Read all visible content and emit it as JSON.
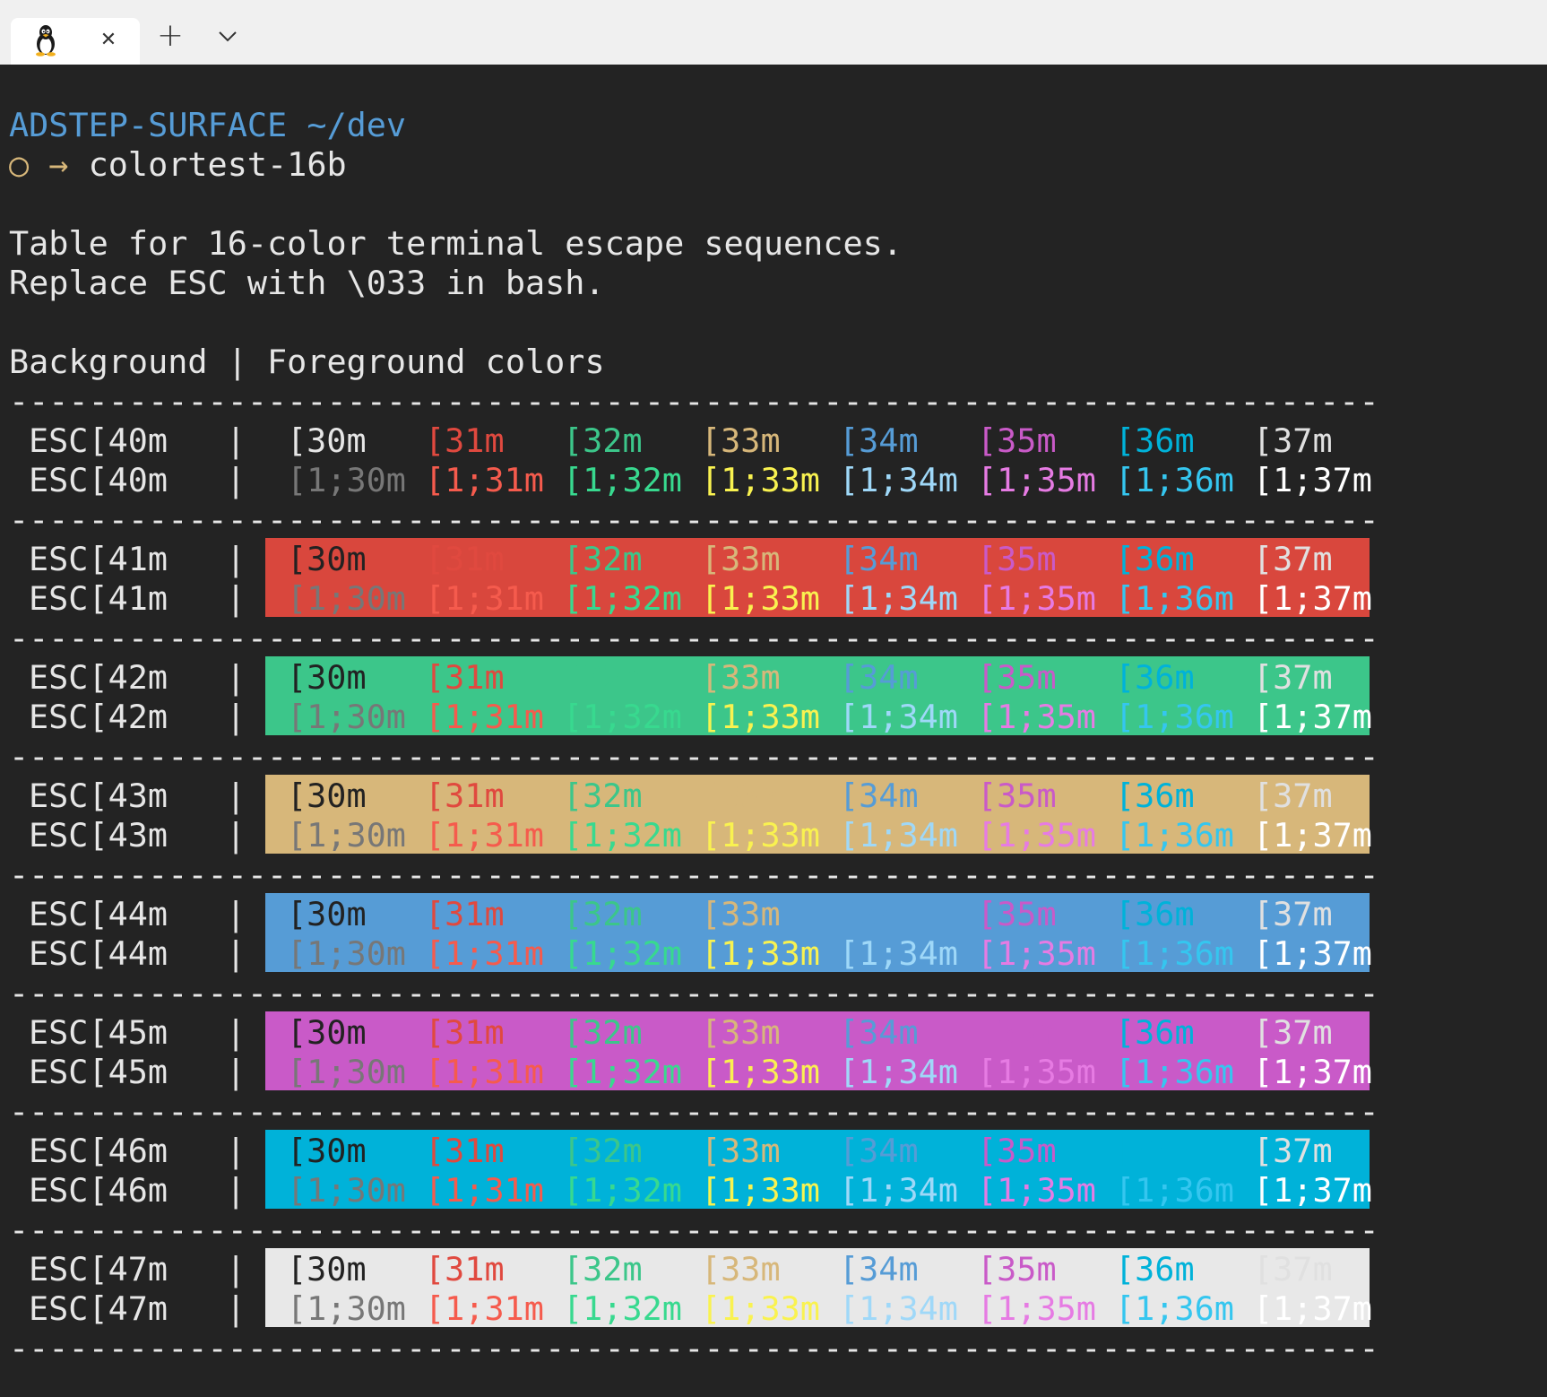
{
  "tabstrip": {
    "tab_icon": "linux-penguin-icon",
    "close_glyph": "✕",
    "new_tab_glyph": "+",
    "menu_glyph": "⌄"
  },
  "terminal": {
    "prompt_host": "ADSTEP-SURFACE",
    "prompt_path": "~/dev",
    "prompt_symbol": "○ →",
    "command": "colortest-16b",
    "info_line1": "Table for 16-color terminal escape sequences.",
    "info_line2": "Replace ESC with \\033 in bash.",
    "header": "Background | Foreground colors",
    "divider": "---------------------------------------------------------------------",
    "pipe": "|",
    "colors": {
      "normal": [
        "#222222",
        "#e0493f",
        "#3cc68a",
        "#d7b77a",
        "#569cd6",
        "#c95ac8",
        "#00b2d9",
        "#e0e0e0"
      ],
      "bright": [
        "#777777",
        "#f55b4d",
        "#38d98f",
        "#f9f250",
        "#9fd8f8",
        "#e67be3",
        "#35c6ef",
        "#ffffff"
      ],
      "background": [
        "#232323",
        "#d9473d",
        "#3cc68a",
        "#d7b77a",
        "#569cd6",
        "#c95ac8",
        "#00b2d9",
        "#e8e8e8"
      ]
    },
    "fg_codes_normal": [
      "[30m",
      "[31m",
      "[32m",
      "[33m",
      "[34m",
      "[35m",
      "[36m",
      "[37m"
    ],
    "fg_codes_bold": [
      "[1;30m",
      "[1;31m",
      "[1;32m",
      "[1;33m",
      "[1;34m",
      "[1;35m",
      "[1;36m",
      "[1;37m"
    ],
    "rows": [
      {
        "label": "ESC[40m"
      },
      {
        "label": "ESC[41m"
      },
      {
        "label": "ESC[42m"
      },
      {
        "label": "ESC[43m"
      },
      {
        "label": "ESC[44m"
      },
      {
        "label": "ESC[45m"
      },
      {
        "label": "ESC[46m"
      },
      {
        "label": "ESC[47m"
      }
    ]
  }
}
